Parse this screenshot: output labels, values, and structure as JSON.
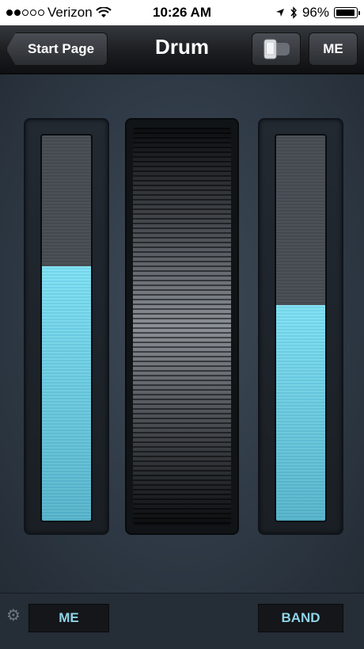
{
  "status_bar": {
    "signal_dots_filled": 2,
    "signal_dots_total": 5,
    "carrier": "Verizon",
    "time": "10:26 AM",
    "battery_percent": "96%",
    "icons": [
      "wifi-icon",
      "location-arrow-icon",
      "bluetooth-icon",
      "battery-icon"
    ]
  },
  "nav": {
    "back_label": "Start Page",
    "title": "Drum",
    "device_button_icon": "phone-devices-icon",
    "me_label": "ME"
  },
  "main": {
    "left_slider_level": 0.66,
    "right_slider_level": 0.56,
    "fill_color": "#6dd3ea",
    "wheel_icon": "jog-wheel"
  },
  "bottom": {
    "settings_icon": "gear-icon",
    "me_label": "ME",
    "band_label": "BAND",
    "label_color": "#8fd3e6"
  }
}
